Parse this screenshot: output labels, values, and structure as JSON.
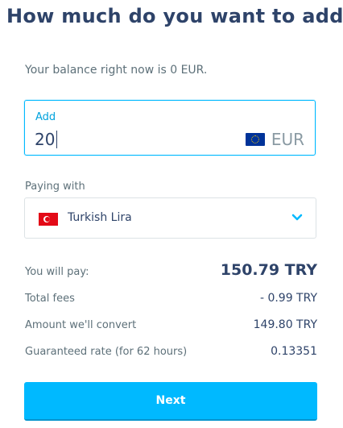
{
  "header": {
    "title": "How much do you want to add?"
  },
  "balance_text": "Your balance right now is 0 EUR.",
  "amount": {
    "label": "Add",
    "value": "20",
    "currency": "EUR",
    "currency_flag": "eu-flag-icon"
  },
  "paying": {
    "label": "Paying with",
    "value": "Turkish Lira",
    "flag": "turkey-flag-icon",
    "dropdown_icon": "chevron-down-icon"
  },
  "summary": {
    "you_will_pay_label": "You will pay:",
    "you_will_pay_value": "150.79 TRY",
    "total_fees_label": "Total fees",
    "total_fees_value": "- 0.99 TRY",
    "convert_label": "Amount we'll convert",
    "convert_value": "149.80 TRY",
    "rate_label": "Guaranteed rate (for 62 hours)",
    "rate_value": "0.13351"
  },
  "next_button": {
    "label": "Next"
  },
  "colors": {
    "accent": "#00b9ff",
    "text_dark": "#2e4369",
    "text_muted": "#5d7079"
  }
}
